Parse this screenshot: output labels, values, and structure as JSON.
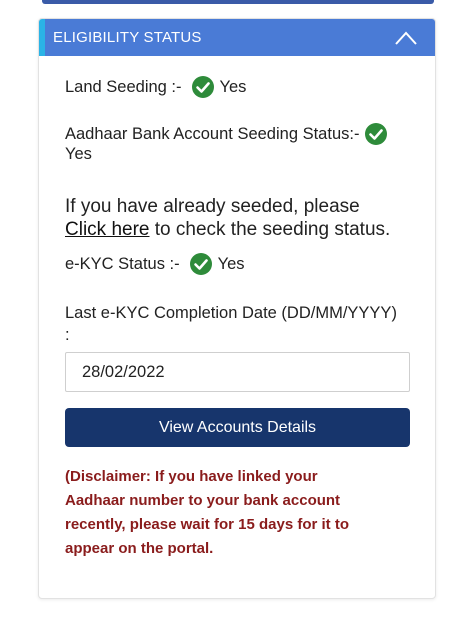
{
  "card": {
    "header_title": "ELIGIBILITY STATUS",
    "collapse_icon": "chevron-up-icon"
  },
  "land_seeding": {
    "label": "Land Seeding :-",
    "value": "Yes",
    "icon": "check-circle-icon"
  },
  "bank_seeding": {
    "label": "Aadhaar Bank Account Seeding Status:-",
    "value": "Yes",
    "icon": "check-circle-icon"
  },
  "seeding_note": {
    "line1": "If you have already seeded, please",
    "link_text": "Click here",
    "line2_rest": " to check the seeding status."
  },
  "ekyc": {
    "label": "e-KYC Status :-",
    "value": "Yes",
    "icon": "check-circle-icon"
  },
  "completion_date": {
    "label": "Last e-KYC Completion Date (DD/MM/YYYY)",
    "label_suffix": ":",
    "value": "28/02/2022"
  },
  "view_button": {
    "label": "View Accounts Details"
  },
  "disclaimer": {
    "line1": "(Disclaimer: If you have linked your",
    "line2": "Aadhaar number to your bank account",
    "line3": "recently, please wait for 15 days for it to",
    "line4": "appear on the portal."
  },
  "colors": {
    "header_bg": "#4a7bd6",
    "header_accent": "#2ab3e6",
    "check_green": "#2e8b3a",
    "button_bg": "#17356c",
    "disclaimer_text": "#8a1c1c"
  }
}
